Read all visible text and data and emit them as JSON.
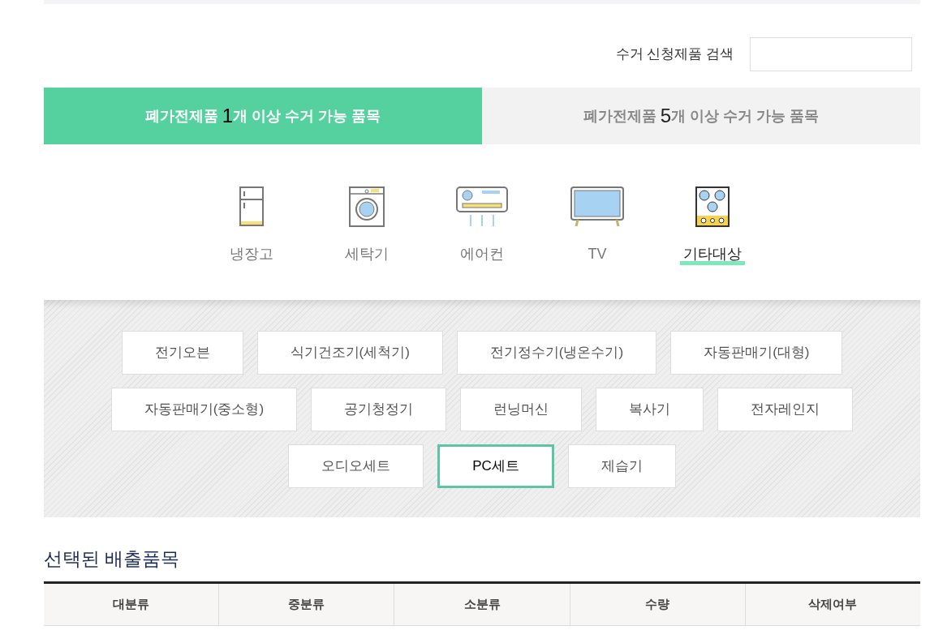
{
  "search": {
    "label": "수거 신청제품 검색"
  },
  "tabs": [
    {
      "before": "폐가전제품 ",
      "count": "1",
      "after": "개 이상 수거 가능 품목",
      "selected": true
    },
    {
      "before": "폐가전제품 ",
      "count": "5",
      "after": "개 이상 수거 가능 품목",
      "selected": false
    }
  ],
  "categories": [
    {
      "kind": "fridge",
      "label": "냉장고",
      "selected": false
    },
    {
      "kind": "washer",
      "label": "세탁기",
      "selected": false
    },
    {
      "kind": "aircon",
      "label": "에어컨",
      "selected": false
    },
    {
      "kind": "tv",
      "label": "TV",
      "selected": false
    },
    {
      "kind": "other",
      "label": "기타대상",
      "selected": true
    }
  ],
  "item_rows": [
    [
      {
        "label": "전기오븐",
        "selected": false
      },
      {
        "label": "식기건조기(세척기)",
        "selected": false
      },
      {
        "label": "전기정수기(냉온수기)",
        "selected": false
      },
      {
        "label": "자동판매기(대형)",
        "selected": false
      }
    ],
    [
      {
        "label": "자동판매기(중소형)",
        "selected": false
      },
      {
        "label": "공기청정기",
        "selected": false
      },
      {
        "label": "런닝머신",
        "selected": false
      },
      {
        "label": "복사기",
        "selected": false
      },
      {
        "label": "전자레인지",
        "selected": false
      }
    ],
    [
      {
        "label": "오디오세트",
        "selected": false
      },
      {
        "label": "PC세트",
        "selected": true
      },
      {
        "label": "제습기",
        "selected": false
      }
    ]
  ],
  "selected_section": {
    "title": "선택된 배출품목",
    "columns": [
      "대분류",
      "중분류",
      "소분류",
      "수량",
      "삭제여부"
    ]
  }
}
